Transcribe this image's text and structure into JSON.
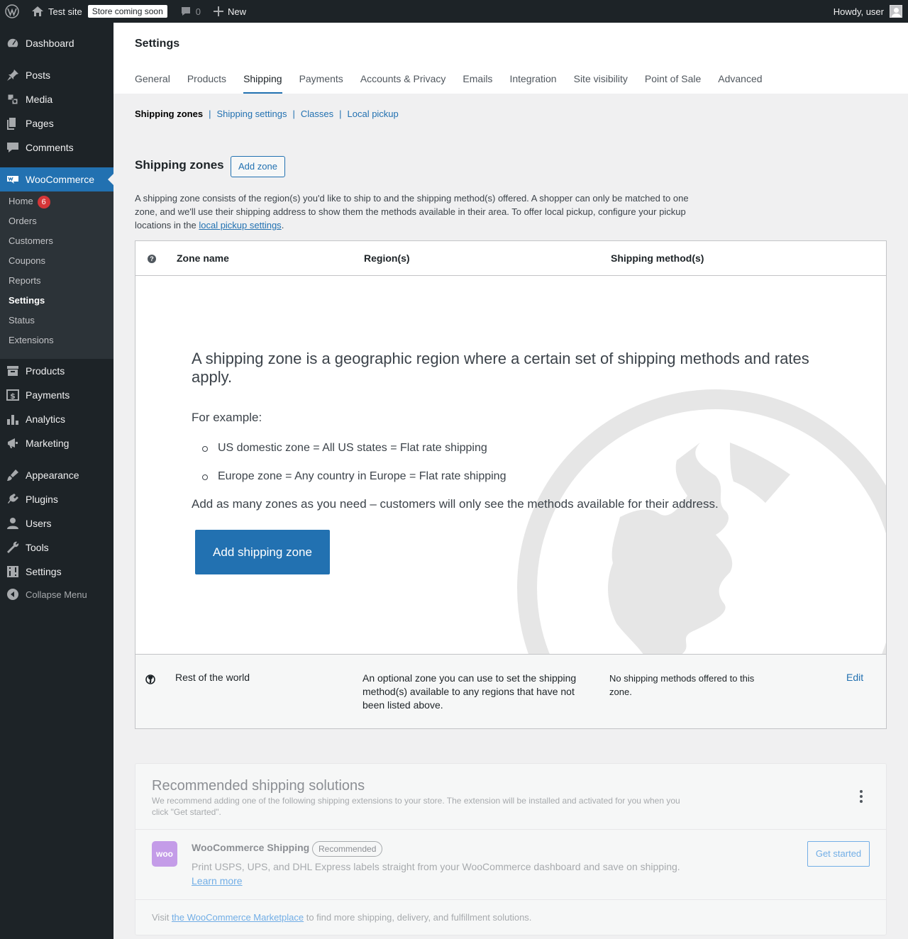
{
  "adminbar": {
    "site_name": "Test site",
    "store_badge": "Store coming soon",
    "comments_count": "0",
    "new_label": "New",
    "howdy": "Howdy, user"
  },
  "sidebar": {
    "items": [
      {
        "label": "Dashboard",
        "icon": "dashboard-icon"
      },
      {
        "label": "Posts",
        "icon": "pin-icon"
      },
      {
        "label": "Media",
        "icon": "media-icon"
      },
      {
        "label": "Pages",
        "icon": "pages-icon"
      },
      {
        "label": "Comments",
        "icon": "comment-icon"
      },
      {
        "label": "WooCommerce",
        "icon": "woo-icon"
      },
      {
        "label": "Products",
        "icon": "archive-icon"
      },
      {
        "label": "Payments",
        "icon": "dollar-icon"
      },
      {
        "label": "Analytics",
        "icon": "bar-chart-icon"
      },
      {
        "label": "Marketing",
        "icon": "megaphone-icon"
      },
      {
        "label": "Appearance",
        "icon": "brush-icon"
      },
      {
        "label": "Plugins",
        "icon": "plug-icon"
      },
      {
        "label": "Users",
        "icon": "user-icon"
      },
      {
        "label": "Tools",
        "icon": "wrench-icon"
      },
      {
        "label": "Settings",
        "icon": "sliders-icon"
      }
    ],
    "woo_submenu": [
      {
        "label": "Home",
        "badge": "6"
      },
      {
        "label": "Orders"
      },
      {
        "label": "Customers"
      },
      {
        "label": "Coupons"
      },
      {
        "label": "Reports"
      },
      {
        "label": "Settings"
      },
      {
        "label": "Status"
      },
      {
        "label": "Extensions"
      }
    ],
    "collapse_label": "Collapse Menu"
  },
  "header": {
    "title": "Settings",
    "tabs": [
      "General",
      "Products",
      "Shipping",
      "Payments",
      "Accounts & Privacy",
      "Emails",
      "Integration",
      "Site visibility",
      "Point of Sale",
      "Advanced"
    ],
    "active_tab": "Shipping"
  },
  "subnav": {
    "items": [
      "Shipping zones",
      "Shipping settings",
      "Classes",
      "Local pickup"
    ],
    "separator": "|"
  },
  "zones_section": {
    "title": "Shipping zones",
    "add_zone_label": "Add zone",
    "description_before": "A shipping zone consists of the region(s) you'd like to ship to and the shipping method(s) offered. A shopper can only be matched to one zone, and we'll use their shipping address to show them the methods available in their area. To offer local pickup, configure your pickup locations in the ",
    "description_link": "local pickup settings",
    "description_after": ".",
    "table_headers": {
      "help": "?",
      "zone_name": "Zone name",
      "regions": "Region(s)",
      "methods": "Shipping method(s)"
    },
    "blank_state": {
      "heading": "A shipping zone is a geographic region where a certain set of shipping methods and rates apply.",
      "example_label": "For example:",
      "examples": [
        "US domestic zone = All US states = Flat rate shipping",
        "Europe zone = Any country in Europe = Flat rate shipping"
      ],
      "footer": "Add as many zones as you need – customers will only see the methods available for their address.",
      "button": "Add shipping zone"
    },
    "rest_of_world": {
      "name": "Rest of the world",
      "region": "An optional zone you can use to set the shipping method(s) available to any regions that have not been listed above.",
      "methods": "No shipping methods offered to this zone.",
      "edit": "Edit"
    }
  },
  "recommended": {
    "title": "Recommended shipping solutions",
    "subtitle": "We recommend adding one of the following shipping extensions to your store. The extension will be installed and activated for you when you click \"Get started\".",
    "extension": {
      "logo_text": "woo",
      "name": "WooCommerce Shipping",
      "badge": "Recommended",
      "description": "Print USPS, UPS, and DHL Express labels straight from your WooCommerce dashboard and save on shipping.",
      "learn_more": "Learn more",
      "button": "Get started"
    },
    "footer_before": "Visit ",
    "footer_link": "the WooCommerce Marketplace",
    "footer_after": " to find more shipping, delivery, and fulfillment solutions."
  },
  "colors": {
    "accent": "#2271b1",
    "admin_dark": "#1d2327",
    "badge_red": "#d63638",
    "woo_purple": "#c49ce8"
  }
}
